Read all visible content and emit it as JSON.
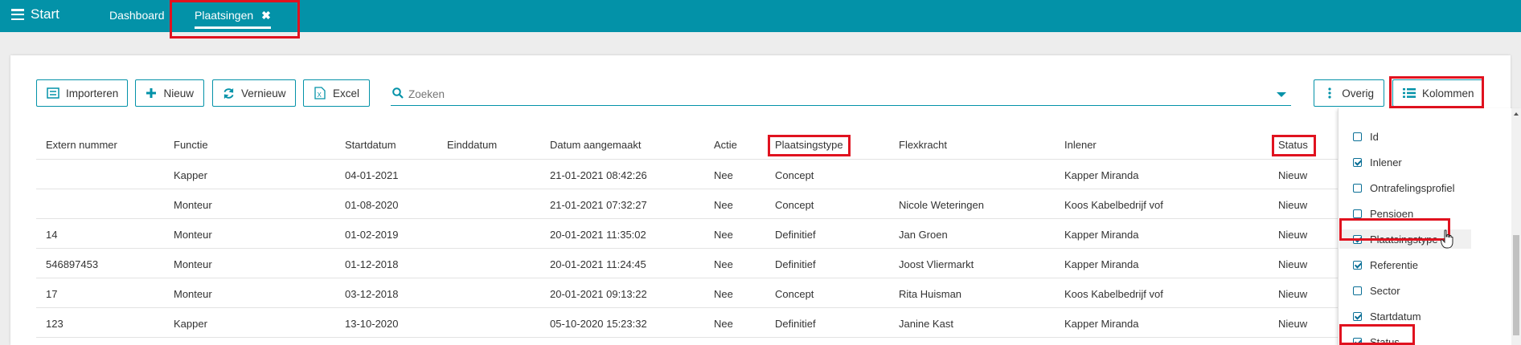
{
  "topbar": {
    "start_label": "Start",
    "tabs": [
      {
        "label": "Dashboard"
      },
      {
        "label": "Plaatsingen",
        "close": "✖"
      }
    ]
  },
  "toolbar": {
    "import_label": "Importeren",
    "new_label": "Nieuw",
    "refresh_label": "Vernieuw",
    "excel_label": "Excel",
    "search_placeholder": "Zoeken",
    "other_label": "Overig",
    "columns_label": "Kolommen"
  },
  "table": {
    "headers": [
      "Extern nummer",
      "Functie",
      "Startdatum",
      "Einddatum",
      "Datum aangemaakt",
      "Actie",
      "Plaatsingstype",
      "Flexkracht",
      "Inlener",
      "Status"
    ],
    "rows": [
      [
        "",
        "Kapper",
        "04-01-2021",
        "",
        "21-01-2021 08:42:26",
        "Nee",
        "Concept",
        "",
        "Kapper Miranda",
        "Nieuw"
      ],
      [
        "",
        "Monteur",
        "01-08-2020",
        "",
        "21-01-2021 07:32:27",
        "Nee",
        "Concept",
        "Nicole Weteringen",
        "Koos Kabelbedrijf vof",
        "Nieuw"
      ],
      [
        "14",
        "Monteur",
        "01-02-2019",
        "",
        "20-01-2021 11:35:02",
        "Nee",
        "Definitief",
        "Jan Groen",
        "Kapper Miranda",
        "Nieuw"
      ],
      [
        "546897453",
        "Monteur",
        "01-12-2018",
        "",
        "20-01-2021 11:24:45",
        "Nee",
        "Definitief",
        "Joost Vliermarkt",
        "Kapper Miranda",
        "Nieuw"
      ],
      [
        "17",
        "Monteur",
        "03-12-2018",
        "",
        "20-01-2021 09:13:22",
        "Nee",
        "Concept",
        "Rita Huisman",
        "Koos Kabelbedrijf vof",
        "Nieuw"
      ],
      [
        "123",
        "Kapper",
        "13-10-2020",
        "",
        "05-10-2020 15:23:32",
        "Nee",
        "Definitief",
        "Janine Kast",
        "Kapper Miranda",
        "Nieuw"
      ]
    ]
  },
  "columns_menu": {
    "items": [
      {
        "label": "Id",
        "checked": false
      },
      {
        "label": "Inlener",
        "checked": true
      },
      {
        "label": "Ontrafelingsprofiel",
        "checked": false
      },
      {
        "label": "Pensioen",
        "checked": false
      },
      {
        "label": "Plaatsingstype",
        "checked": true
      },
      {
        "label": "Referentie",
        "checked": true
      },
      {
        "label": "Sector",
        "checked": false
      },
      {
        "label": "Startdatum",
        "checked": true
      },
      {
        "label": "Status",
        "checked": true
      }
    ]
  },
  "colors": {
    "accent": "#0392a8",
    "highlight": "#e0121f"
  }
}
